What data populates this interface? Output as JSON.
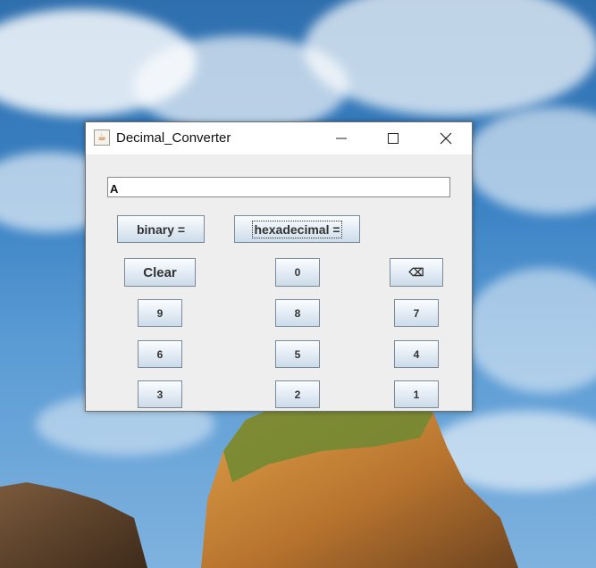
{
  "window": {
    "title": "Decimal_Converter",
    "icon": "java-cup-icon",
    "controls": [
      "minimize-icon",
      "maximize-icon",
      "close-icon"
    ]
  },
  "display": {
    "value": "A"
  },
  "conversions": {
    "binary_label": "binary =",
    "hex_label": "hexadecimal ="
  },
  "keypad": {
    "clear": "Clear",
    "zero": "0",
    "backspace": "⌫",
    "nine": "9",
    "eight": "8",
    "seven": "7",
    "six": "6",
    "five": "5",
    "four": "4",
    "three": "3",
    "two": "2",
    "one": "1"
  }
}
